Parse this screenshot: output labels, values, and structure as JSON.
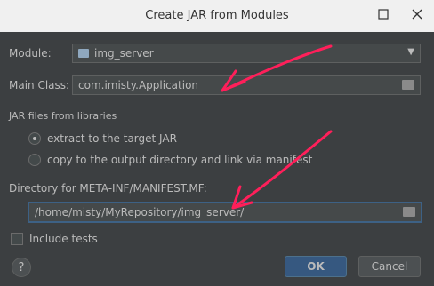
{
  "window": {
    "title": "Create JAR from Modules"
  },
  "module": {
    "label": "Module:",
    "value": "img_server"
  },
  "main_class": {
    "label": "Main Class:",
    "value": "com.imisty.Application"
  },
  "jar_files": {
    "section_label": "JAR files from libraries",
    "options": [
      {
        "label": "extract to the target JAR",
        "selected": true
      },
      {
        "label": "copy to the output directory and link via manifest",
        "selected": false
      }
    ]
  },
  "manifest_dir": {
    "label": "Directory for META-INF/MANIFEST.MF:",
    "value": "/home/misty/MyRepository/img_server/"
  },
  "include_tests": {
    "label": "Include tests",
    "checked": false
  },
  "buttons": {
    "help": "?",
    "ok": "OK",
    "cancel": "Cancel"
  },
  "icons": {
    "minimize": "minimize-icon",
    "close": "close-icon"
  },
  "colors": {
    "annotation": "#ff1f5a",
    "ok_button": "#365880"
  }
}
